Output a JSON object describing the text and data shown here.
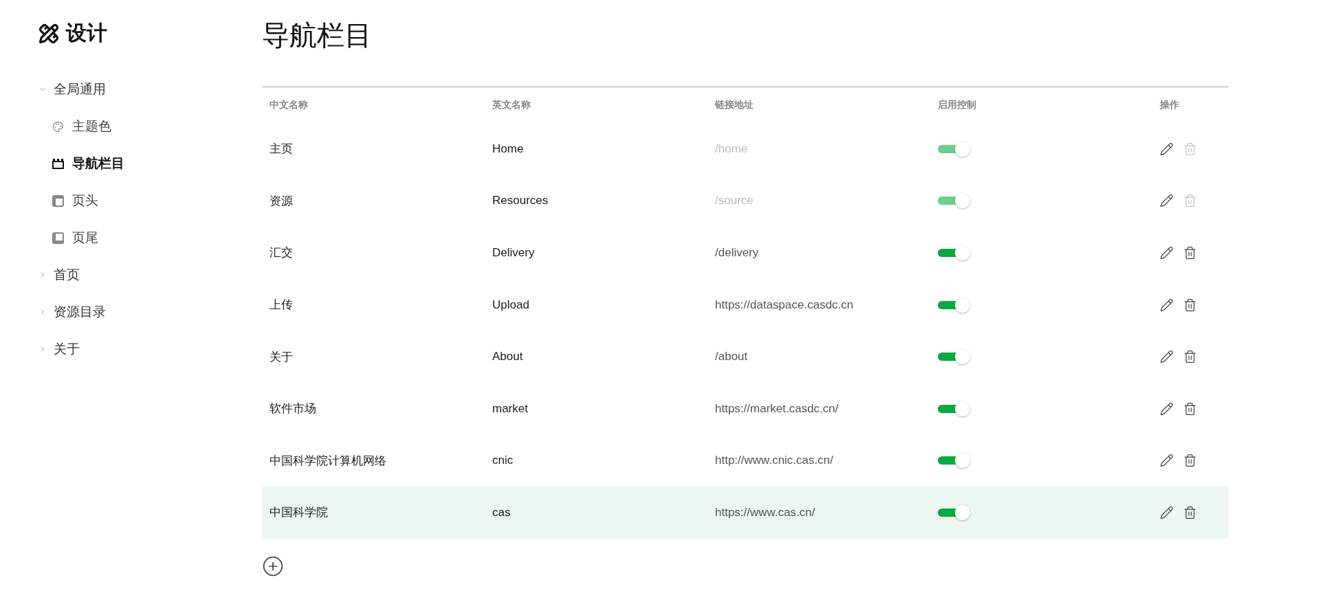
{
  "sidebar": {
    "title": "设计",
    "items": [
      {
        "label": "全局通用",
        "expanded": true,
        "children": [
          {
            "label": "主题色",
            "selected": false
          },
          {
            "label": "导航栏目",
            "selected": true
          },
          {
            "label": "页头",
            "selected": false
          },
          {
            "label": "页尾",
            "selected": false
          }
        ]
      },
      {
        "label": "首页",
        "expanded": false
      },
      {
        "label": "资源目录",
        "expanded": false
      },
      {
        "label": "关于",
        "expanded": false
      }
    ]
  },
  "page_title": "导航栏目",
  "table": {
    "columns": [
      "中文名称",
      "英文名称",
      "链接地址",
      "启用控制",
      "操作"
    ],
    "rows": [
      {
        "name_zh": "主页",
        "name_en": "Home",
        "link": "/home",
        "enabled": true,
        "locked": true,
        "highlighted": false
      },
      {
        "name_zh": "资源",
        "name_en": "Resources",
        "link": "/source",
        "enabled": true,
        "locked": true,
        "highlighted": false
      },
      {
        "name_zh": "汇交",
        "name_en": "Delivery",
        "link": "/delivery",
        "enabled": true,
        "locked": false,
        "highlighted": false
      },
      {
        "name_zh": "上传",
        "name_en": "Upload",
        "link": "https://dataspace.casdc.cn",
        "enabled": true,
        "locked": false,
        "highlighted": false
      },
      {
        "name_zh": "关于",
        "name_en": "About",
        "link": "/about",
        "enabled": true,
        "locked": false,
        "highlighted": false
      },
      {
        "name_zh": "软件市场",
        "name_en": "market",
        "link": "https://market.casdc.cn/",
        "enabled": true,
        "locked": false,
        "highlighted": false
      },
      {
        "name_zh": "中国科学院计算机网络",
        "name_en": "cnic",
        "link": "http://www.cnic.cas.cn/",
        "enabled": true,
        "locked": false,
        "highlighted": false
      },
      {
        "name_zh": "中国科学院",
        "name_en": "cas",
        "link": "https://www.cas.cn/",
        "enabled": true,
        "locked": false,
        "highlighted": true
      }
    ]
  }
}
